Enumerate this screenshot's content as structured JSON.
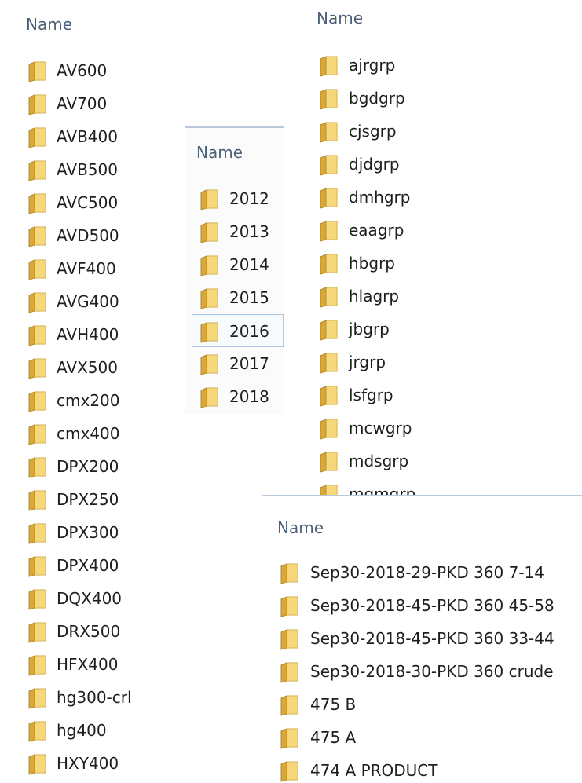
{
  "column_header": "Name",
  "panels": [
    {
      "items": [
        "AV600",
        "AV700",
        "AVB400",
        "AVB500",
        "AVC500",
        "AVD500",
        "AVF400",
        "AVG400",
        "AVH400",
        "AVX500",
        "cmx200",
        "cmx400",
        "DPX200",
        "DPX250",
        "DPX300",
        "DPX400",
        "DQX400",
        "DRX500",
        "HFX400",
        "hg300-crl",
        "hg400",
        "HXY400"
      ]
    },
    {
      "items": [
        "2012",
        "2013",
        "2014",
        "2015",
        "2016",
        "2017",
        "2018"
      ],
      "selected": "2016"
    },
    {
      "items": [
        "ajrgrp",
        "bgdgrp",
        "cjsgrp",
        "djdgrp",
        "dmhgrp",
        "eaagrp",
        "hbgrp",
        "hlagrp",
        "jbgrp",
        "jrgrp",
        "lsfgrp",
        "mcwgrp",
        "mdsgrp",
        "mgmgrp"
      ]
    },
    {
      "items": [
        "Sep30-2018-29-PKD 360 7-14",
        "Sep30-2018-45-PKD 360 45-58",
        "Sep30-2018-45-PKD 360 33-44",
        "Sep30-2018-30-PKD 360 crude",
        "475 B",
        "475 A",
        "474 A PRODUCT"
      ]
    }
  ],
  "icons": {
    "folder": "folder-icon"
  },
  "colors": {
    "header_text": "#4c607a",
    "item_text": "#1e1e1e",
    "folder_front": "#f6d87a",
    "folder_back": "#d9a836",
    "selection_border": "#a9c6e6",
    "divider": "#b9c9da"
  }
}
